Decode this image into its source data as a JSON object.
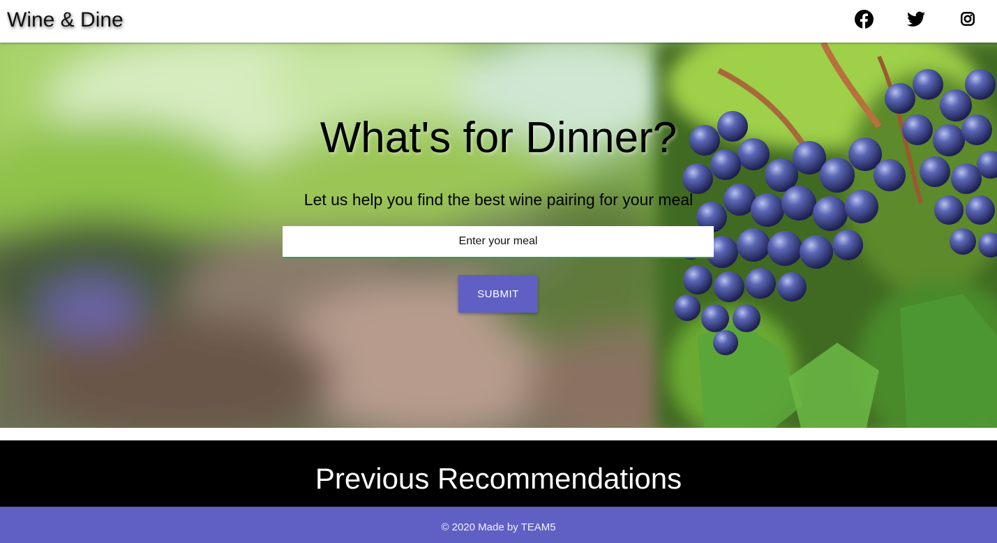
{
  "navbar": {
    "brand": "Wine & Dine",
    "social": [
      {
        "icon": "facebook-icon"
      },
      {
        "icon": "twitter-icon"
      },
      {
        "icon": "instagram-icon"
      }
    ]
  },
  "hero": {
    "title": "What's for Dinner?",
    "subtitle": "Let us help you find the best wine pairing for your meal",
    "input_placeholder": "Enter your meal",
    "submit_label": "SUBMIT",
    "background": "vineyard-with-grapes-photo"
  },
  "previous": {
    "title": "Previous Recommendations"
  },
  "footer": {
    "text": "© 2020 Made by TEAM5"
  },
  "colors": {
    "accent": "#5f5fc4",
    "input_underline": "#2aa14a",
    "prev_bg": "#000000",
    "navbar_bg": "#ffffff"
  }
}
